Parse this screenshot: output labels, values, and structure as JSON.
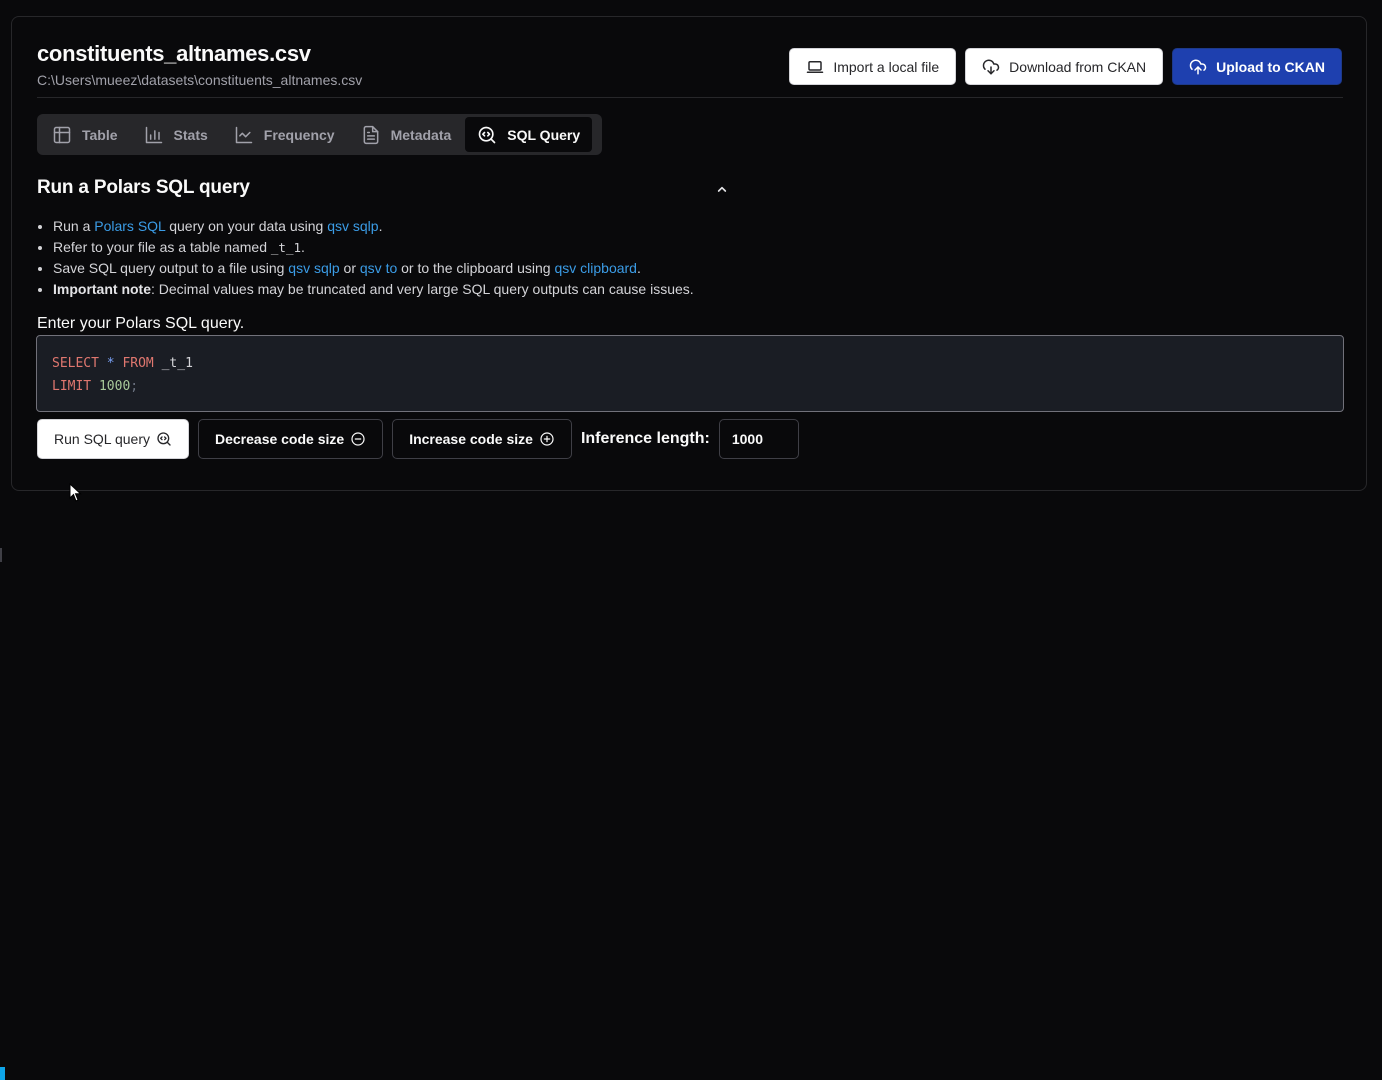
{
  "header": {
    "file_name": "constituents_altnames.csv",
    "file_path": "C:\\Users\\mueez\\datasets\\constituents_altnames.csv"
  },
  "actions": {
    "import_label": "Import a local file",
    "download_label": "Download from CKAN",
    "upload_label": "Upload to CKAN"
  },
  "tabs": [
    {
      "label": "Table",
      "icon": "table-icon",
      "active": false
    },
    {
      "label": "Stats",
      "icon": "bar-chart-icon",
      "active": false
    },
    {
      "label": "Frequency",
      "icon": "line-chart-icon",
      "active": false
    },
    {
      "label": "Metadata",
      "icon": "file-text-icon",
      "active": false
    },
    {
      "label": "SQL Query",
      "icon": "search-code-icon",
      "active": true
    }
  ],
  "sql_section": {
    "title": "Run a Polars SQL query",
    "bullets": {
      "b1_pre": "Run a ",
      "b1_link1": "Polars SQL",
      "b1_mid": " query on your data using ",
      "b1_link2": "qsv sqlp",
      "b1_post": ".",
      "b2_pre": "Refer to your file as a table named ",
      "b2_code": "_t_1",
      "b2_post": ".",
      "b3_pre": "Save SQL query output to a file using ",
      "b3_link1": "qsv sqlp",
      "b3_mid1": " or ",
      "b3_link2": "qsv to",
      "b3_mid2": " or to the clipboard using ",
      "b3_link3": "qsv clipboard",
      "b3_post": ".",
      "b4_bold": "Important note",
      "b4_text": ": Decimal values may be truncated and very large SQL query outputs can cause issues."
    },
    "query_label": "Enter your Polars SQL query.",
    "query": {
      "line1": {
        "kw1": "SELECT",
        "op": "*",
        "kw2": "FROM",
        "table": "_t_1"
      },
      "line2": {
        "kw": "LIMIT",
        "num": "1000",
        "end": ";"
      }
    }
  },
  "controls": {
    "run_label": "Run SQL query",
    "decrease_label": "Decrease code size",
    "increase_label": "Increase code size",
    "inference_label": "Inference length:",
    "inference_value": "1000"
  },
  "colors": {
    "accent": "#1e40af",
    "link": "#3b9ce6",
    "background": "#09090b"
  }
}
